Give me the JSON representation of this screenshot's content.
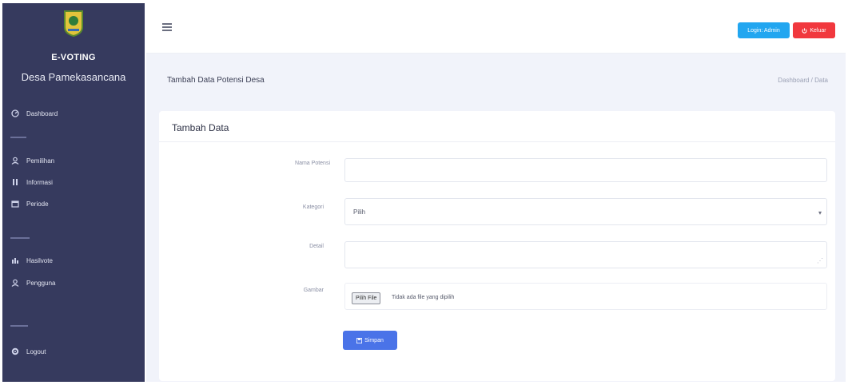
{
  "sidebar": {
    "brand_title": "E-VOTING",
    "brand_subtitle": "Desa Pamekasancana",
    "items": [
      {
        "label": "Dashboard",
        "icon": "dashboard-icon"
      },
      {
        "label": "Pemilihan",
        "icon": "user-icon"
      },
      {
        "label": "Informasi",
        "icon": "list-icon"
      },
      {
        "label": "Periode",
        "icon": "calendar-icon"
      },
      {
        "label": "Hasilvote",
        "icon": "bar-chart-icon"
      },
      {
        "label": "Pengguna",
        "icon": "user-icon"
      },
      {
        "label": "Logout",
        "icon": "settings-icon"
      }
    ],
    "headings": [
      "",
      "",
      ""
    ]
  },
  "header": {
    "user_label": "Login: Admin",
    "logout_label": "Keluar"
  },
  "page": {
    "title": "Tambah Data Potensi Desa",
    "breadcrumb": "Dashboard / Data"
  },
  "form": {
    "card_title": "Tambah Data",
    "name_label": "Nama Potensi",
    "name_value": "",
    "category_label": "Kategori",
    "category_value": "Pilih",
    "detail_label": "Detail",
    "detail_value": "",
    "image_label": "Gambar",
    "file_button": "Pilih File",
    "file_status": "Tidak ada file yang dipilih",
    "save_label": "Simpan"
  },
  "colors": {
    "sidebar": "#363a5e",
    "primary": "#4a73e8",
    "info": "#22a6f0",
    "danger": "#f1383e"
  }
}
